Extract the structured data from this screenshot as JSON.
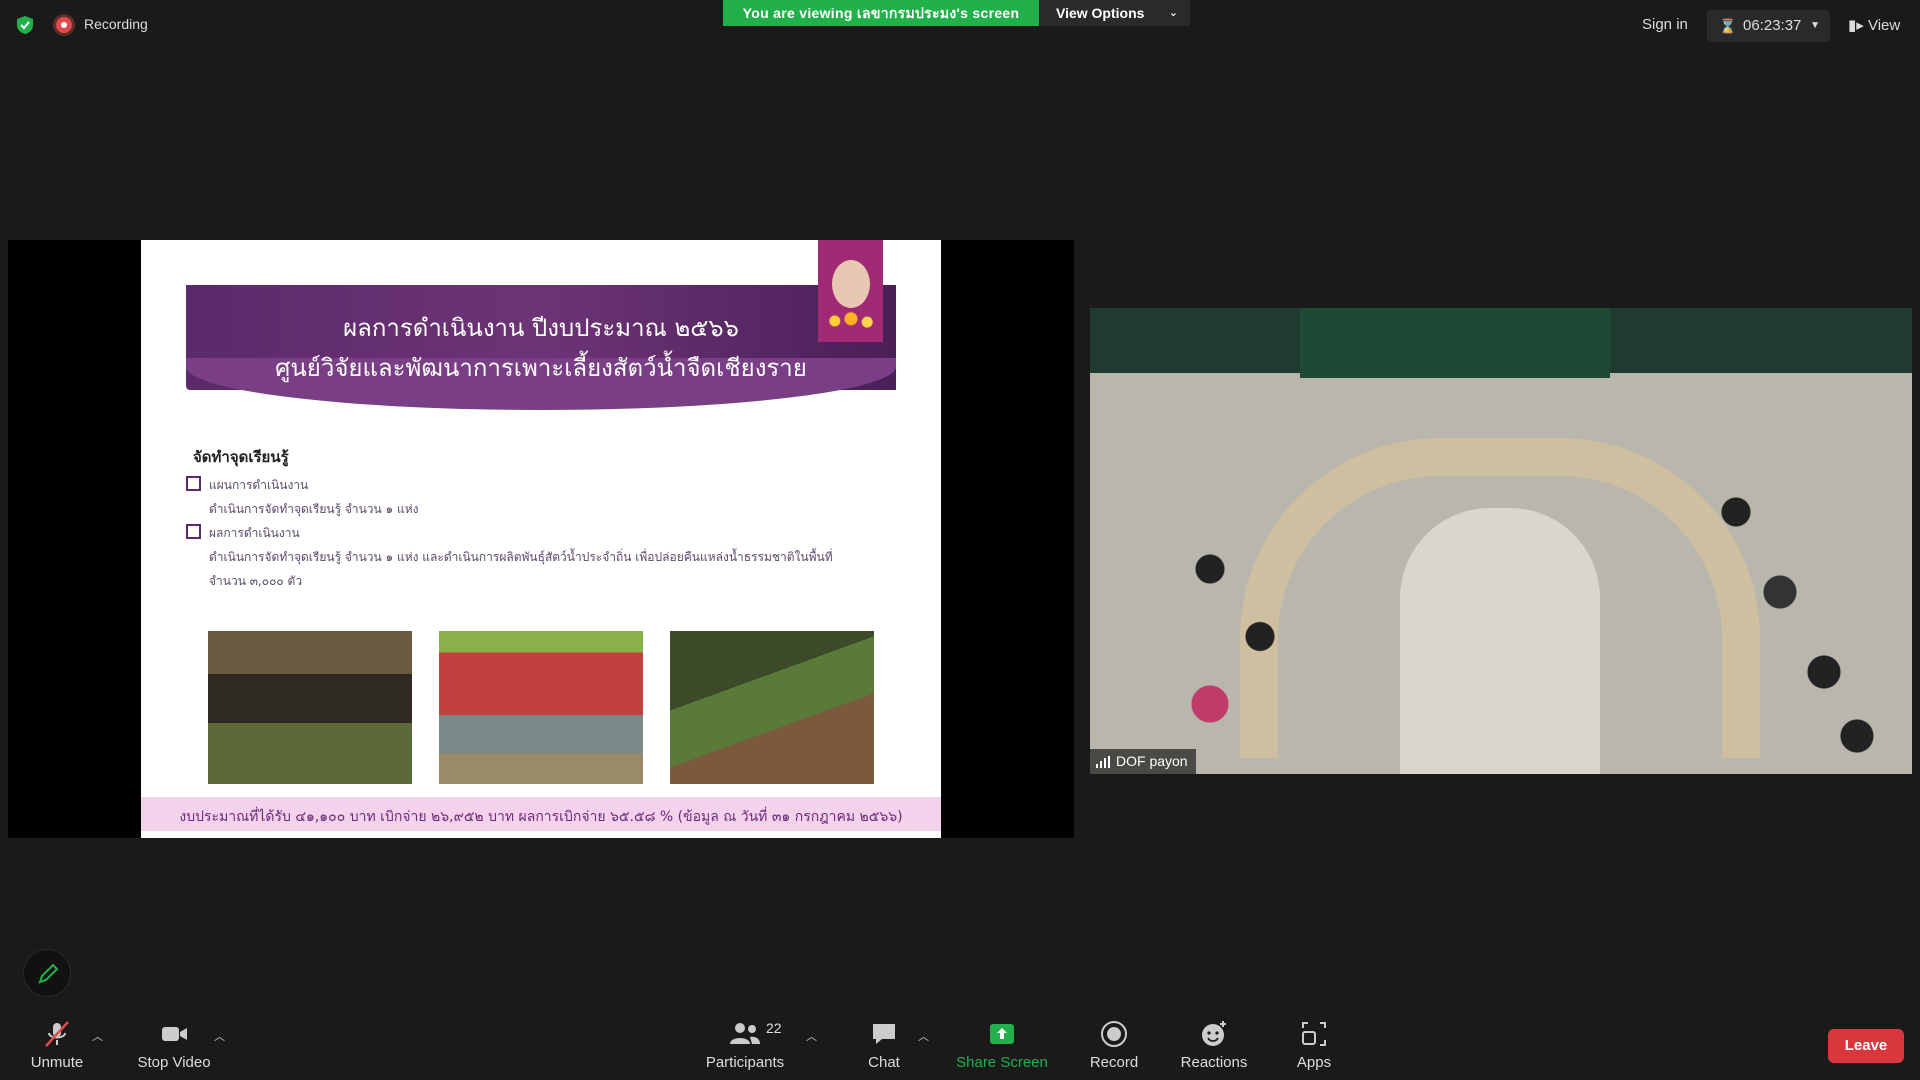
{
  "top_bar": {
    "recording_label": "Recording",
    "viewing_banner": "You are viewing เลขากรมประมง's screen",
    "view_options_label": "View Options",
    "sign_in_label": "Sign in",
    "timer": "06:23:37",
    "view_label": "View"
  },
  "slide": {
    "title_line1": "ผลการดำเนินงาน ปีงบประมาณ ๒๕๖๖",
    "title_line2": "ศูนย์วิจัยและพัฒนาการเพาะเลี้ยงสัตว์น้ำจืดเชียงราย",
    "subheading": "จัดทำจุดเรียนรู้",
    "bullets": [
      {
        "label": "แผนการดำเนินงาน",
        "detail": "ดำเนินการจัดทำจุดเรียนรู้ จำนวน ๑ แห่ง"
      },
      {
        "label": "ผลการดำเนินงาน",
        "detail": "ดำเนินการจัดทำจุดเรียนรู้ จำนวน ๑ แห่ง และดำเนินการผลิตพันธุ์สัตว์น้ำประจำถิ่น เพื่อปล่อยคืนแหล่งน้ำธรรมชาติในพื้นที่",
        "detail2": "จำนวน ๓,๐๐๐ ตัว"
      }
    ],
    "footer": "งบประมาณที่ได้รับ ๔๑,๑๐๐ บาท เบิกจ่าย ๒๖,๙๕๒ บาท ผลการเบิกจ่าย ๖๕.๕๘ % (ข้อมูล ณ วันที่ ๓๑ กรกฎาคม ๒๕๖๖)"
  },
  "video": {
    "participant_name": "DOF payon"
  },
  "toolbar": {
    "unmute_label": "Unmute",
    "stop_video_label": "Stop Video",
    "participants_count": "22",
    "participants_label": "Participants",
    "chat_label": "Chat",
    "share_screen_label": "Share Screen",
    "record_label": "Record",
    "reactions_label": "Reactions",
    "apps_label": "Apps",
    "leave_label": "Leave"
  },
  "colors": {
    "share_green": "#22b04a",
    "leave_red": "#d9363e",
    "slide_purple": "#5b2a6a"
  }
}
